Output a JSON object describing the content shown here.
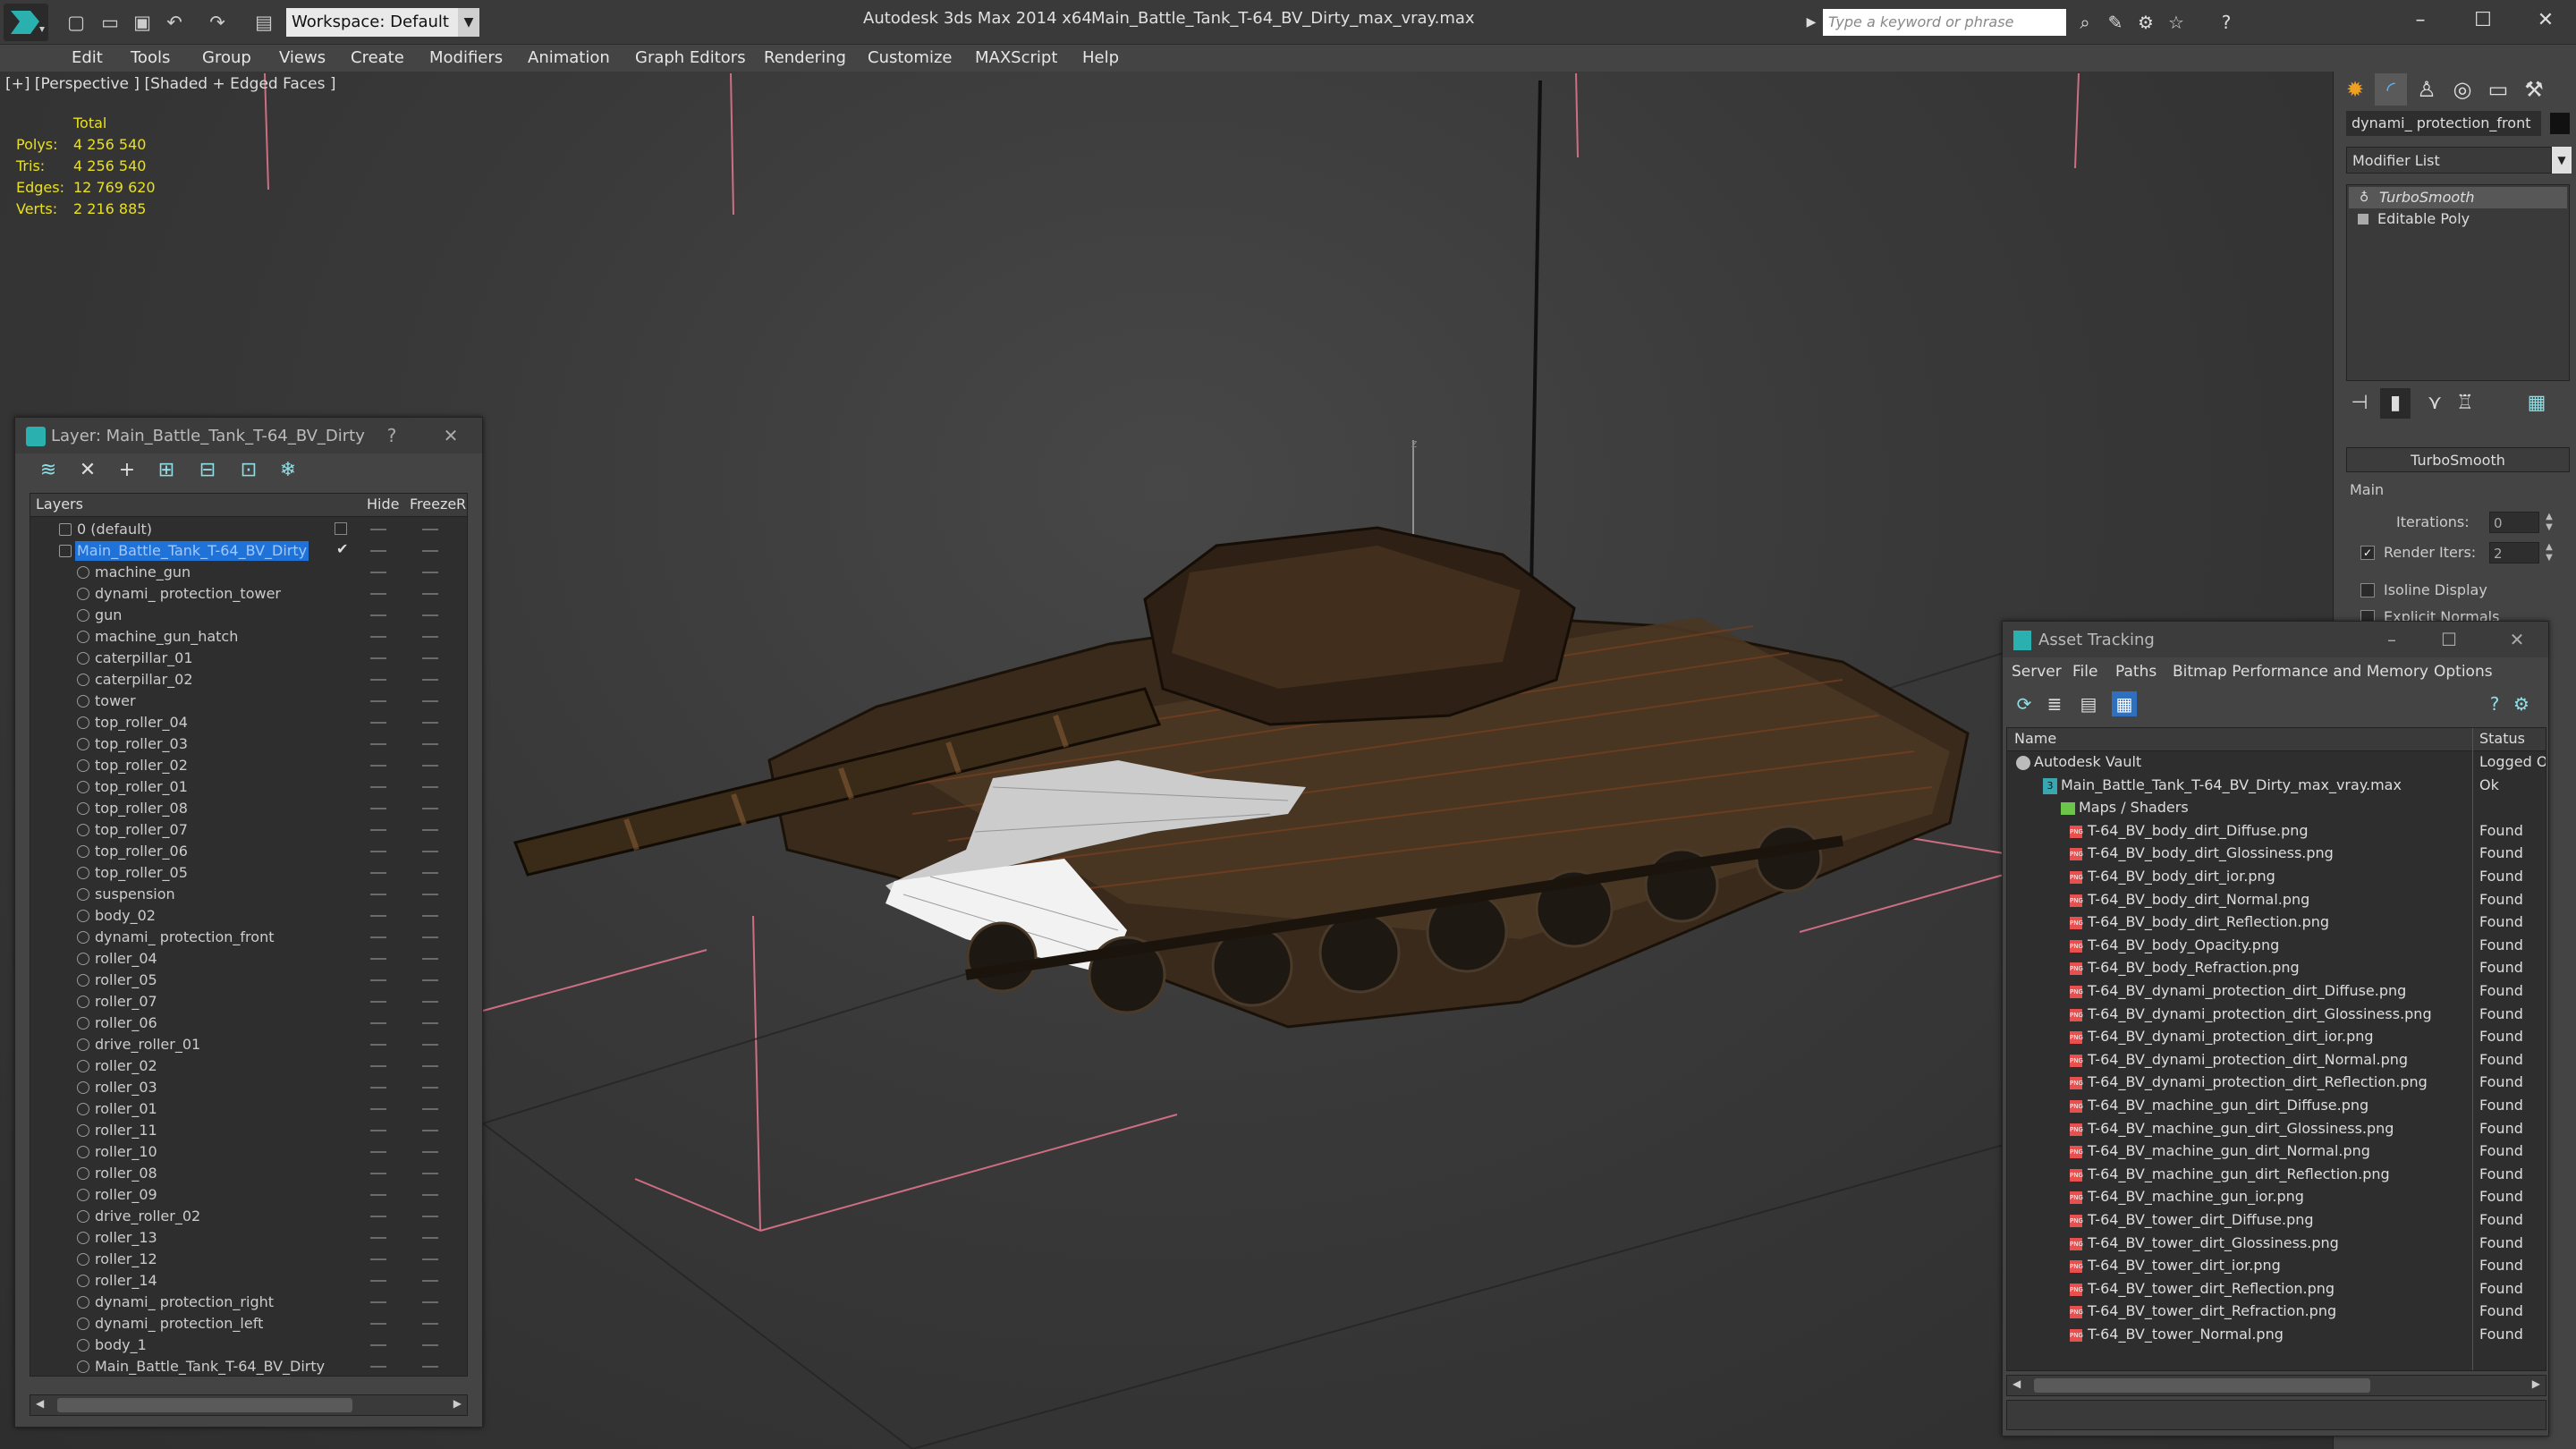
{
  "titlebar": {
    "workspace": "Workspace: Default",
    "app_title": "Autodesk 3ds Max  2014 x64",
    "file_title": "Main_Battle_Tank_T-64_BV_Dirty_max_vray.max",
    "search_placeholder": "Type a keyword or phrase",
    "window_controls": [
      "–",
      "☐",
      "✕"
    ]
  },
  "menubar": [
    "Edit",
    "Tools",
    "Group",
    "Views",
    "Create",
    "Modifiers",
    "Animation",
    "Graph Editors",
    "Rendering",
    "Customize",
    "MAXScript",
    "Help"
  ],
  "viewport": {
    "label": "[+] [Perspective ] [Shaded + Edged Faces ]",
    "stats": {
      "header": "Total",
      "rows": [
        {
          "key": "Polys:",
          "value": "4 256 540"
        },
        {
          "key": "Tris:",
          "value": "4 256 540"
        },
        {
          "key": "Edges:",
          "value": "12 769 620"
        },
        {
          "key": "Verts:",
          "value": "2 216 885"
        }
      ]
    }
  },
  "layer_panel": {
    "title": "Layer: Main_Battle_Tank_T-64_BV_Dirty",
    "help": "?",
    "close": "✕",
    "columns": [
      "Layers",
      "Hide",
      "Freeze",
      "R"
    ],
    "rows": [
      {
        "name": "0 (default)",
        "kind": "layer"
      },
      {
        "name": "Main_Battle_Tank_T-64_BV_Dirty",
        "kind": "layer",
        "selected": true
      },
      {
        "name": "machine_gun",
        "kind": "obj"
      },
      {
        "name": "dynami_ protection_tower",
        "kind": "obj"
      },
      {
        "name": "gun",
        "kind": "obj"
      },
      {
        "name": "machine_gun_hatch",
        "kind": "obj"
      },
      {
        "name": "caterpillar_01",
        "kind": "obj"
      },
      {
        "name": "caterpillar_02",
        "kind": "obj"
      },
      {
        "name": "tower",
        "kind": "obj"
      },
      {
        "name": "top_roller_04",
        "kind": "obj"
      },
      {
        "name": "top_roller_03",
        "kind": "obj"
      },
      {
        "name": "top_roller_02",
        "kind": "obj"
      },
      {
        "name": "top_roller_01",
        "kind": "obj"
      },
      {
        "name": "top_roller_08",
        "kind": "obj"
      },
      {
        "name": "top_roller_07",
        "kind": "obj"
      },
      {
        "name": "top_roller_06",
        "kind": "obj"
      },
      {
        "name": "top_roller_05",
        "kind": "obj"
      },
      {
        "name": "suspension",
        "kind": "obj"
      },
      {
        "name": "body_02",
        "kind": "obj"
      },
      {
        "name": "dynami_ protection_front",
        "kind": "obj"
      },
      {
        "name": "roller_04",
        "kind": "obj"
      },
      {
        "name": "roller_05",
        "kind": "obj"
      },
      {
        "name": "roller_07",
        "kind": "obj"
      },
      {
        "name": "roller_06",
        "kind": "obj"
      },
      {
        "name": "drive_roller_01",
        "kind": "obj"
      },
      {
        "name": "roller_02",
        "kind": "obj"
      },
      {
        "name": "roller_03",
        "kind": "obj"
      },
      {
        "name": "roller_01",
        "kind": "obj"
      },
      {
        "name": "roller_11",
        "kind": "obj"
      },
      {
        "name": "roller_10",
        "kind": "obj"
      },
      {
        "name": "roller_08",
        "kind": "obj"
      },
      {
        "name": "roller_09",
        "kind": "obj"
      },
      {
        "name": "drive_roller_02",
        "kind": "obj"
      },
      {
        "name": "roller_13",
        "kind": "obj"
      },
      {
        "name": "roller_12",
        "kind": "obj"
      },
      {
        "name": "roller_14",
        "kind": "obj"
      },
      {
        "name": "dynami_ protection_right",
        "kind": "obj"
      },
      {
        "name": "dynami_ protection_left",
        "kind": "obj"
      },
      {
        "name": "body_1",
        "kind": "obj"
      },
      {
        "name": "Main_Battle_Tank_T-64_BV_Dirty",
        "kind": "obj"
      }
    ]
  },
  "command_panel": {
    "object_name": "dynami_ protection_front",
    "modifier_list": "Modifier List",
    "stack": [
      "TurboSmooth",
      "Editable Poly"
    ],
    "rollout_title": "TurboSmooth",
    "group_label": "Main",
    "iterations_label": "Iterations:",
    "iterations_value": "0",
    "render_iters_label": "Render Iters:",
    "render_iters_value": "2",
    "render_iters_checked": true,
    "isoline_label": "Isoline Display",
    "explicit_normals_label": "Explicit Normals"
  },
  "asset_panel": {
    "title": "Asset Tracking",
    "menus": [
      "Server",
      "File",
      "Paths",
      "Bitmap Performance and Memory",
      "Options"
    ],
    "columns": [
      "Name",
      "Status"
    ],
    "rows": [
      {
        "name": "Autodesk Vault",
        "status": "Logged O",
        "level": 0,
        "icon": "vault"
      },
      {
        "name": "Main_Battle_Tank_T-64_BV_Dirty_max_vray.max",
        "status": "Ok",
        "level": 1,
        "icon": "max"
      },
      {
        "name": "Maps / Shaders",
        "status": "",
        "level": 2,
        "icon": "folder"
      },
      {
        "name": "T-64_BV_body_dirt_Diffuse.png",
        "status": "Found",
        "level": 3,
        "icon": "png"
      },
      {
        "name": "T-64_BV_body_dirt_Glossiness.png",
        "status": "Found",
        "level": 3,
        "icon": "png"
      },
      {
        "name": "T-64_BV_body_dirt_ior.png",
        "status": "Found",
        "level": 3,
        "icon": "png"
      },
      {
        "name": "T-64_BV_body_dirt_Normal.png",
        "status": "Found",
        "level": 3,
        "icon": "png"
      },
      {
        "name": "T-64_BV_body_dirt_Reflection.png",
        "status": "Found",
        "level": 3,
        "icon": "png"
      },
      {
        "name": "T-64_BV_body_Opacity.png",
        "status": "Found",
        "level": 3,
        "icon": "png"
      },
      {
        "name": "T-64_BV_body_Refraction.png",
        "status": "Found",
        "level": 3,
        "icon": "png"
      },
      {
        "name": "T-64_BV_dynami_protection_dirt_Diffuse.png",
        "status": "Found",
        "level": 3,
        "icon": "png"
      },
      {
        "name": "T-64_BV_dynami_protection_dirt_Glossiness.png",
        "status": "Found",
        "level": 3,
        "icon": "png"
      },
      {
        "name": "T-64_BV_dynami_protection_dirt_ior.png",
        "status": "Found",
        "level": 3,
        "icon": "png"
      },
      {
        "name": "T-64_BV_dynami_protection_dirt_Normal.png",
        "status": "Found",
        "level": 3,
        "icon": "png"
      },
      {
        "name": "T-64_BV_dynami_protection_dirt_Reflection.png",
        "status": "Found",
        "level": 3,
        "icon": "png"
      },
      {
        "name": "T-64_BV_machine_gun_dirt_Diffuse.png",
        "status": "Found",
        "level": 3,
        "icon": "png"
      },
      {
        "name": "T-64_BV_machine_gun_dirt_Glossiness.png",
        "status": "Found",
        "level": 3,
        "icon": "png"
      },
      {
        "name": "T-64_BV_machine_gun_dirt_Normal.png",
        "status": "Found",
        "level": 3,
        "icon": "png"
      },
      {
        "name": "T-64_BV_machine_gun_dirt_Reflection.png",
        "status": "Found",
        "level": 3,
        "icon": "png"
      },
      {
        "name": "T-64_BV_machine_gun_ior.png",
        "status": "Found",
        "level": 3,
        "icon": "png"
      },
      {
        "name": "T-64_BV_tower_dirt_Diffuse.png",
        "status": "Found",
        "level": 3,
        "icon": "png"
      },
      {
        "name": "T-64_BV_tower_dirt_Glossiness.png",
        "status": "Found",
        "level": 3,
        "icon": "png"
      },
      {
        "name": "T-64_BV_tower_dirt_ior.png",
        "status": "Found",
        "level": 3,
        "icon": "png"
      },
      {
        "name": "T-64_BV_tower_dirt_Reflection.png",
        "status": "Found",
        "level": 3,
        "icon": "png"
      },
      {
        "name": "T-64_BV_tower_dirt_Refraction.png",
        "status": "Found",
        "level": 3,
        "icon": "png"
      },
      {
        "name": "T-64_BV_tower_Normal.png",
        "status": "Found",
        "level": 3,
        "icon": "png"
      }
    ]
  },
  "colors": {
    "selection": "#1e72d8",
    "stats_text": "#e8e020",
    "accent_icon": "#8ee0e6",
    "grid_axis": "#e87890",
    "png_badge": "#e85050"
  }
}
